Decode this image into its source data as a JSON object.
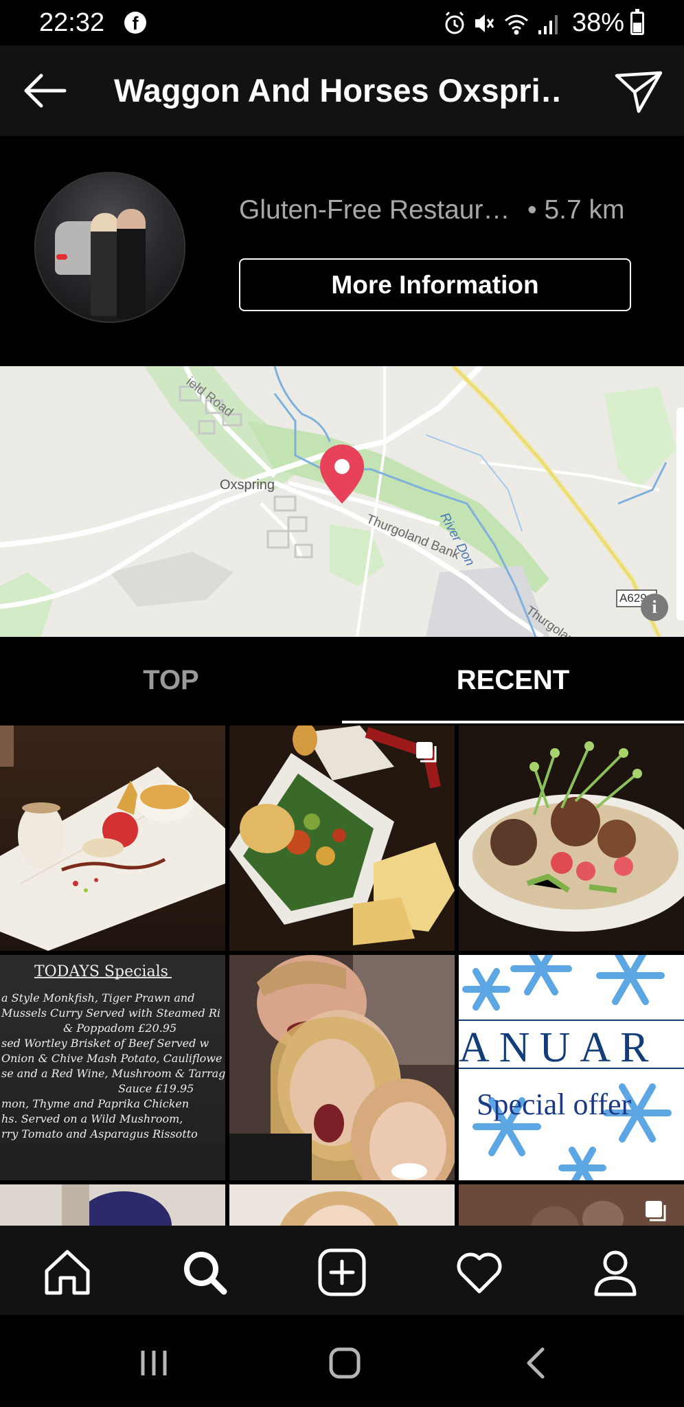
{
  "status_bar": {
    "time": "22:32",
    "app_icon": "facebook-icon",
    "battery_percent": "38%",
    "icons": [
      "alarm-icon",
      "mute-icon",
      "wifi-icon",
      "signal-icon",
      "battery-icon"
    ]
  },
  "header": {
    "title": "Waggon And Horses Oxspri…",
    "back_icon": "arrow-left-icon",
    "share_icon": "send-icon"
  },
  "profile": {
    "category": "Gluten-Free Restaur…",
    "distance": "• 5.7 km",
    "more_info_label": "More Information"
  },
  "map": {
    "labels": {
      "town": "Oxspring",
      "road1": "ield Road",
      "road2": "Thurgoland Bank",
      "river": "River Don",
      "road3": "Thurgoland",
      "road_marker": "A629"
    },
    "info_glyph": "i",
    "pin_color": "#e8415a"
  },
  "tabs": {
    "top": "TOP",
    "recent": "RECENT",
    "active": "RECENT"
  },
  "grid": {
    "chalkboard": {
      "heading": "TODAYS Specials",
      "lines": [
        "a Style Monkfish, Tiger Prawn and",
        "Mussels Curry Served with Steamed Ri",
        "& Poppadom £20.95",
        "sed Wortley Brisket of Beef Served w",
        "Onion & Chive Mash Potato, Cauliflowe",
        "se and a Red Wine, Mushroom & Tarrago",
        "Sauce £19.95",
        "mon, Thyme and Paprika Chicken",
        "hs. Served on a Wild Mushroom,",
        "rry Tomato and Asparagus Rissotto"
      ]
    },
    "offer": {
      "word": "ANUAR",
      "caption": "Special offer"
    }
  },
  "bottom_nav": [
    "home-icon",
    "search-icon",
    "add-post-icon",
    "activity-heart-icon",
    "profile-icon"
  ],
  "android_nav": [
    "recent-apps-icon",
    "home-button-icon",
    "back-icon"
  ]
}
